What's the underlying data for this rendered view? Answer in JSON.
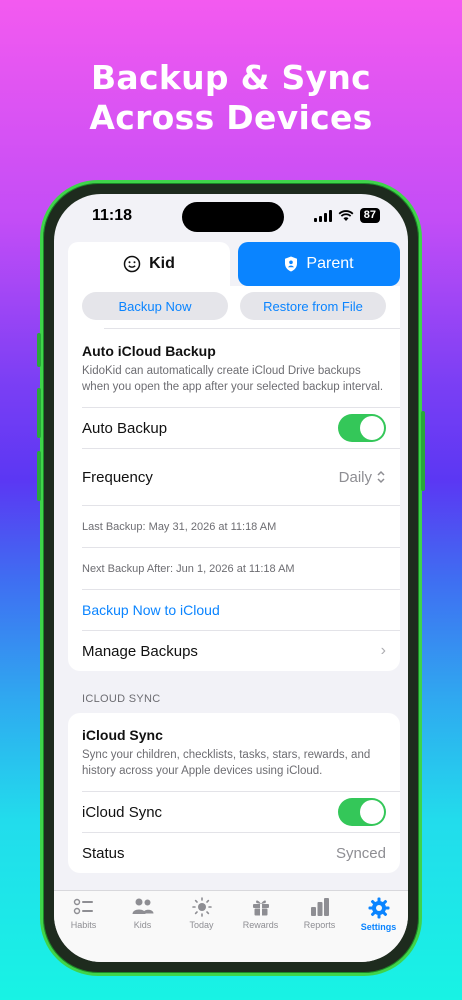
{
  "headline": {
    "line1": "Backup & Sync",
    "line2": "Across Devices"
  },
  "status_bar": {
    "time": "11:18",
    "battery": "87"
  },
  "segmented": {
    "kid_label": "Kid",
    "parent_label": "Parent"
  },
  "backup_buttons": {
    "backup_now": "Backup Now",
    "restore": "Restore from File"
  },
  "auto_backup_section": {
    "title": "Auto iCloud Backup",
    "description": "KidoKid can automatically create iCloud Drive backups when you open the app after your selected backup interval.",
    "auto_backup_label": "Auto Backup",
    "auto_backup_on": true,
    "frequency_label": "Frequency",
    "frequency_value": "Daily",
    "last_backup": "Last Backup: May 31, 2026 at 11:18 AM",
    "next_backup": "Next Backup After: Jun 1, 2026 at 11:18 AM",
    "backup_now_icloud": "Backup Now to iCloud",
    "manage_backups": "Manage Backups"
  },
  "icloud_sync_group": {
    "header": "ICLOUD SYNC",
    "title": "iCloud Sync",
    "description": "Sync your children, checklists, tasks, stars, rewards, and history across your Apple devices using iCloud.",
    "toggle_label": "iCloud Sync",
    "toggle_on": true,
    "status_label": "Status",
    "status_value": "Synced"
  },
  "tabbar": {
    "tabs": [
      {
        "label": "Habits",
        "icon": "checklist-icon"
      },
      {
        "label": "Kids",
        "icon": "people-icon"
      },
      {
        "label": "Today",
        "icon": "sun-icon"
      },
      {
        "label": "Rewards",
        "icon": "gift-icon"
      },
      {
        "label": "Reports",
        "icon": "bar-chart-icon"
      },
      {
        "label": "Settings",
        "icon": "gear-icon"
      }
    ],
    "active": "Settings"
  },
  "colors": {
    "accent": "#0a84ff",
    "toggle_on": "#34c759",
    "phone_frame": "#3fd44a"
  }
}
